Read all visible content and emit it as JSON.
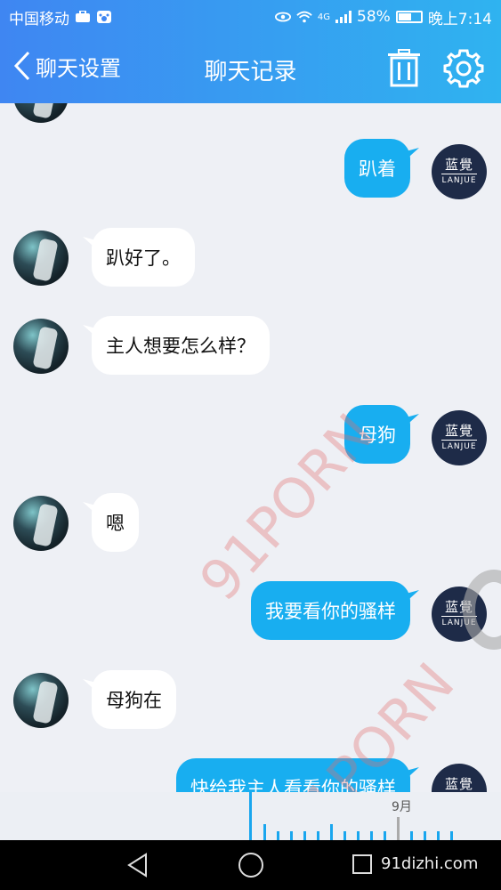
{
  "status_bar": {
    "carrier": "中国移动",
    "network": "4G",
    "battery": "58%",
    "battery_level": 0.58,
    "time": "晚上7:14"
  },
  "header": {
    "back_label": "聊天设置",
    "title": "聊天记录",
    "icons": [
      "trash-icon",
      "gear-icon"
    ]
  },
  "me": {
    "avatar_cn": "蓝覺",
    "avatar_en": "LANJUE"
  },
  "messages": [
    {
      "side": "out",
      "text": "趴着"
    },
    {
      "side": "in",
      "text": "趴好了。"
    },
    {
      "side": "in",
      "text": "主人想要怎么样？"
    },
    {
      "side": "out",
      "text": "母狗"
    },
    {
      "side": "in",
      "text": "嗯"
    },
    {
      "side": "out",
      "text": "我要看你的骚样"
    },
    {
      "side": "in",
      "text": "母狗在"
    },
    {
      "side": "out",
      "text": "快给我主人看看你的骚样"
    }
  ],
  "watermark": "91PORN",
  "timeline": {
    "month": "9月"
  },
  "nav": {
    "site": "91dizhi.com"
  },
  "colors": {
    "accent": "#18aef0",
    "header_start": "#3f86f2",
    "header_end": "#2fb3f0",
    "avatar_dark": "#1e2b48"
  }
}
